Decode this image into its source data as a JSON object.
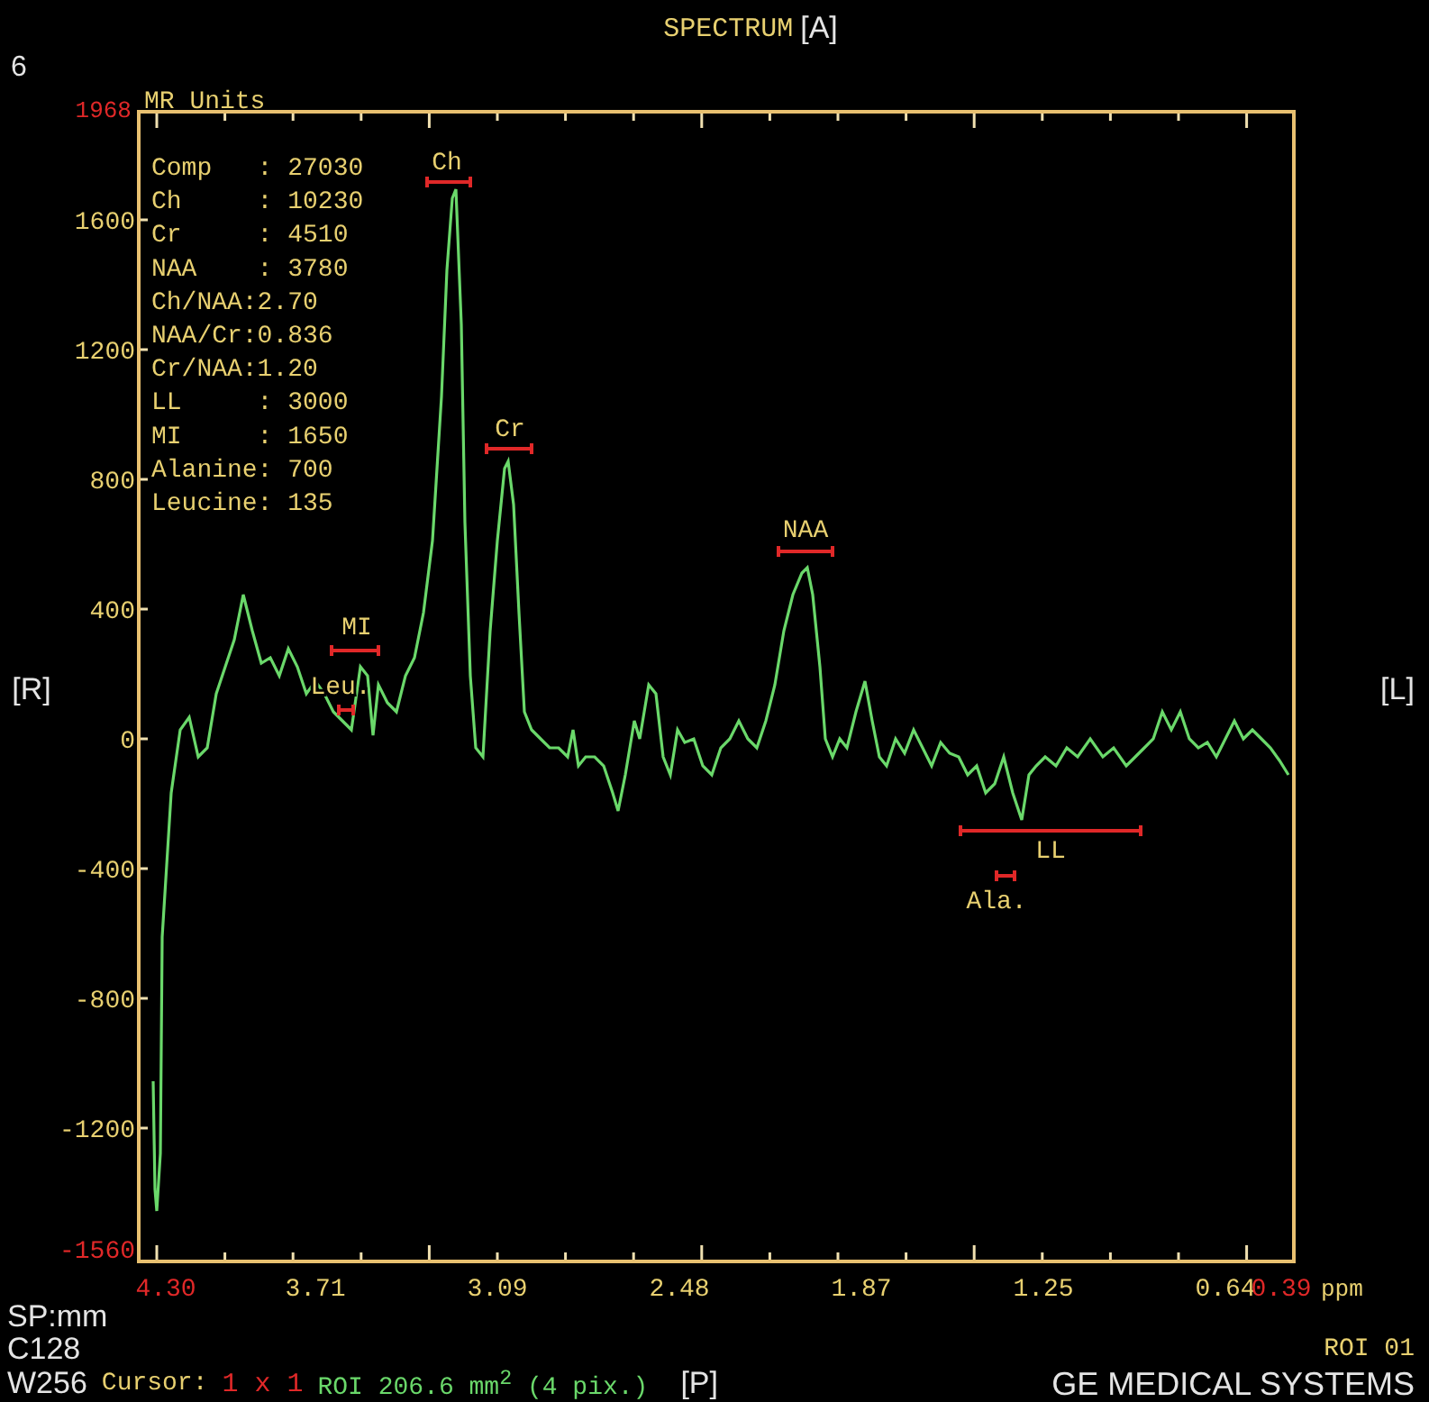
{
  "title": "SPECTRUM",
  "orientation_top": "[A]",
  "series_number": "6",
  "y_axis": {
    "max_label": "1968",
    "unit": "MR Units",
    "labels": [
      "1600",
      "1200",
      "800",
      "400",
      "0",
      "-400",
      "-800",
      "-1200"
    ],
    "min_label": "-1560"
  },
  "metrics": [
    "Comp   : 27030",
    "Ch     : 10230",
    "Cr     : 4510",
    "NAA    : 3780",
    "Ch/NAA:2.70",
    "NAA/Cr:0.836",
    "Cr/NAA:1.20",
    "LL     : 3000",
    "MI     : 1650",
    "Alanine: 700",
    "Leucine: 135"
  ],
  "peak_labels": [
    "Ch",
    "Cr",
    "NAA",
    "MI",
    "Leu.",
    "LL",
    "Ala."
  ],
  "x_axis": {
    "start_label": "4.30",
    "labels": [
      "3.71",
      "3.09",
      "2.48",
      "1.87",
      "1.25",
      "0.64"
    ],
    "end_label": "0.39",
    "unit": "ppm"
  },
  "orientation_left": "[R]",
  "orientation_right": "[L]",
  "orientation_bottom": "[P]",
  "footer": {
    "sp": "SP:mm",
    "center": "C128",
    "width": "W256",
    "cursor_label": "Cursor:",
    "cursor_size": "1 x 1",
    "roi_info": "ROI 206.6 mm$^{2}$ (4 pix.)",
    "roi_name": "ROI 01",
    "manufacturer": "GE MEDICAL SYSTEMS"
  }
}
